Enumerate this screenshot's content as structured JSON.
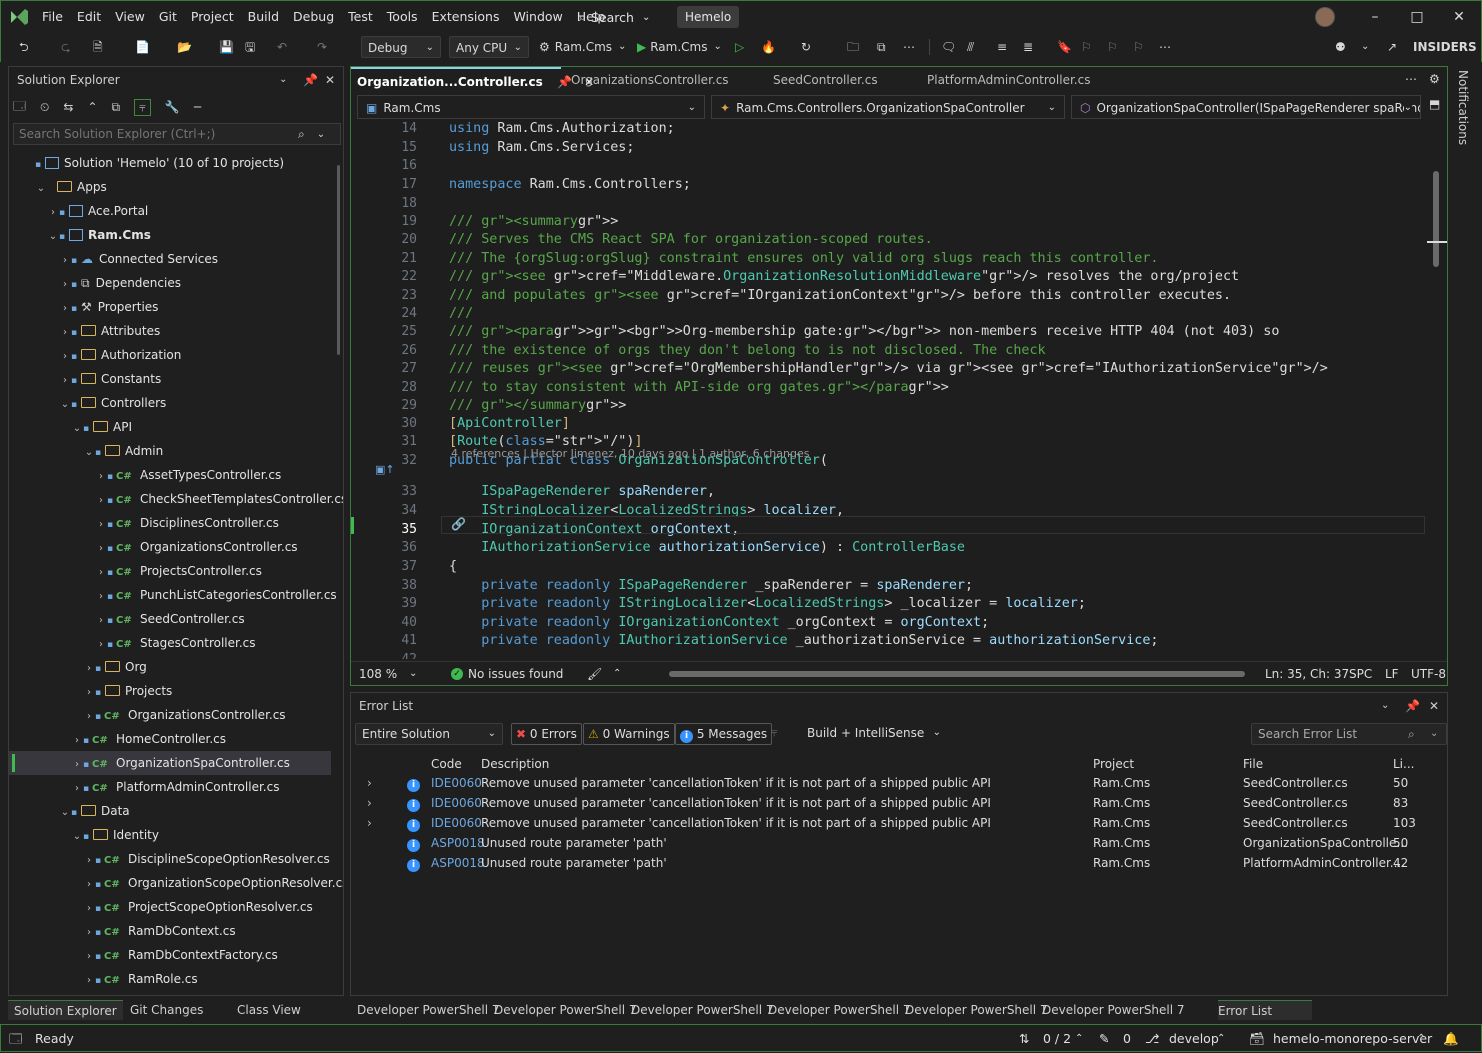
{
  "menu": [
    "File",
    "Edit",
    "View",
    "Git",
    "Project",
    "Build",
    "Debug",
    "Test",
    "Tools",
    "Extensions",
    "Window",
    "Help"
  ],
  "search_label": "Search",
  "solution_name": "Hemelo",
  "toolbar": {
    "config": "Debug",
    "platform": "Any CPU",
    "startup": "Ram.Cms",
    "run": "Ram.Cms",
    "insiders": "INSIDERS"
  },
  "solution_explorer": {
    "title": "Solution Explorer",
    "search_placeholder": "Search Solution Explorer (Ctrl+;)",
    "items": [
      {
        "label": "Solution 'Hemelo' (10 of 10 projects)",
        "kind": "solution"
      },
      {
        "label": "Apps",
        "kind": "folder"
      },
      {
        "label": "Ace.Portal",
        "kind": "project"
      },
      {
        "label": "Ram.Cms",
        "kind": "project"
      },
      {
        "label": "Connected Services",
        "kind": "service"
      },
      {
        "label": "Dependencies",
        "kind": "deps"
      },
      {
        "label": "Properties",
        "kind": "props"
      },
      {
        "label": "Attributes",
        "kind": "folder"
      },
      {
        "label": "Authorization",
        "kind": "folder"
      },
      {
        "label": "Constants",
        "kind": "folder"
      },
      {
        "label": "Controllers",
        "kind": "folder"
      },
      {
        "label": "API",
        "kind": "folder"
      },
      {
        "label": "Admin",
        "kind": "folder"
      },
      {
        "label": "AssetTypesController.cs",
        "kind": "cs"
      },
      {
        "label": "CheckSheetTemplatesController.cs",
        "kind": "cs"
      },
      {
        "label": "DisciplinesController.cs",
        "kind": "cs"
      },
      {
        "label": "OrganizationsController.cs",
        "kind": "cs"
      },
      {
        "label": "ProjectsController.cs",
        "kind": "cs"
      },
      {
        "label": "PunchListCategoriesController.cs",
        "kind": "cs"
      },
      {
        "label": "SeedController.cs",
        "kind": "cs"
      },
      {
        "label": "StagesController.cs",
        "kind": "cs"
      },
      {
        "label": "Org",
        "kind": "folder"
      },
      {
        "label": "Projects",
        "kind": "folder"
      },
      {
        "label": "OrganizationsController.cs",
        "kind": "cs"
      },
      {
        "label": "HomeController.cs",
        "kind": "cs"
      },
      {
        "label": "OrganizationSpaController.cs",
        "kind": "cs"
      },
      {
        "label": "PlatformAdminController.cs",
        "kind": "cs"
      },
      {
        "label": "Data",
        "kind": "folder"
      },
      {
        "label": "Identity",
        "kind": "folder"
      },
      {
        "label": "DisciplineScopeOptionResolver.cs",
        "kind": "cs"
      },
      {
        "label": "OrganizationScopeOptionResolver.cs",
        "kind": "cs"
      },
      {
        "label": "ProjectScopeOptionResolver.cs",
        "kind": "cs"
      },
      {
        "label": "RamDbContext.cs",
        "kind": "cs"
      },
      {
        "label": "RamDbContextFactory.cs",
        "kind": "cs"
      },
      {
        "label": "RamRole.cs",
        "kind": "cs"
      }
    ],
    "bottom_tabs": [
      "Solution Explorer",
      "Git Changes",
      "Class View"
    ]
  },
  "editor": {
    "tabs": [
      "Organization...Controller.cs",
      "OrganizationsController.cs",
      "SeedController.cs",
      "PlatformAdminController.cs"
    ],
    "nav_project": "Ram.Cms",
    "nav_class": "Ram.Cms.Controllers.OrganizationSpaController",
    "nav_member": "OrganizationSpaController(ISpaPageRenderer spaRender",
    "codelens": "4 references | Hector Jimenez, 10 days ago | 1 author, 6 changes",
    "zoom": "108 %",
    "issues": "No issues found",
    "position": "Ln: 35, Ch: 37",
    "spc": "SPC",
    "eol": "LF",
    "encoding": "UTF-8"
  },
  "code_lines": [
    {
      "n": "14",
      "t": "using Ram.Cms.Authorization;"
    },
    {
      "n": "15",
      "t": "using Ram.Cms.Services;"
    },
    {
      "n": "16",
      "t": ""
    },
    {
      "n": "17",
      "t": "namespace Ram.Cms.Controllers;"
    },
    {
      "n": "18",
      "t": ""
    },
    {
      "n": "19",
      "t": "/// <summary>"
    },
    {
      "n": "20",
      "t": "/// Serves the CMS React SPA for organization-scoped routes."
    },
    {
      "n": "21",
      "t": "/// The {orgSlug:orgSlug} constraint ensures only valid org slugs reach this controller."
    },
    {
      "n": "22",
      "t": "/// <see cref=\"Middleware.OrganizationResolutionMiddleware\"/> resolves the org/project"
    },
    {
      "n": "23",
      "t": "/// and populates <see cref=\"IOrganizationContext\"/> before this controller executes."
    },
    {
      "n": "24",
      "t": "///"
    },
    {
      "n": "25",
      "t": "/// <para><b>Org-membership gate:</b> non-members receive HTTP 404 (not 403) so"
    },
    {
      "n": "26",
      "t": "/// the existence of orgs they don't belong to is not disclosed. The check"
    },
    {
      "n": "27",
      "t": "/// reuses <see cref=\"OrgMembershipHandler\"/> via <see cref=\"IAuthorizationService\"/>"
    },
    {
      "n": "28",
      "t": "/// to stay consistent with API-side org gates.</para>"
    },
    {
      "n": "29",
      "t": "/// </summary>"
    },
    {
      "n": "30",
      "t": "[ApiController]"
    },
    {
      "n": "31",
      "t": "[Route(\"/\")]"
    },
    {
      "n": "32",
      "t": "public partial class OrganizationSpaController("
    },
    {
      "n": "33",
      "t": "    ISpaPageRenderer spaRenderer,"
    },
    {
      "n": "34",
      "t": "    IStringLocalizer<LocalizedStrings> localizer,"
    },
    {
      "n": "35",
      "t": "    IOrganizationContext orgContext,"
    },
    {
      "n": "36",
      "t": "    IAuthorizationService authorizationService) : ControllerBase"
    },
    {
      "n": "37",
      "t": "{"
    },
    {
      "n": "38",
      "t": "    private readonly ISpaPageRenderer _spaRenderer = spaRenderer;"
    },
    {
      "n": "39",
      "t": "    private readonly IStringLocalizer<LocalizedStrings> _localizer = localizer;"
    },
    {
      "n": "40",
      "t": "    private readonly IOrganizationContext _orgContext = orgContext;"
    },
    {
      "n": "41",
      "t": "    private readonly IAuthorizationService _authorizationService = authorizationService;"
    },
    {
      "n": "42",
      "t": ""
    }
  ],
  "error_list": {
    "title": "Error List",
    "scope": "Entire Solution",
    "errors": "0 Errors",
    "warnings": "0 Warnings",
    "messages": "5 Messages",
    "source": "Build + IntelliSense",
    "search_placeholder": "Search Error List",
    "columns": [
      "Code",
      "Description",
      "Project",
      "File",
      "Li..."
    ],
    "rows": [
      {
        "code": "IDE0060",
        "desc": "Remove unused parameter 'cancellationToken' if it is not part of a shipped public API",
        "project": "Ram.Cms",
        "file": "SeedController.cs",
        "line": "50",
        "expandable": true
      },
      {
        "code": "IDE0060",
        "desc": "Remove unused parameter 'cancellationToken' if it is not part of a shipped public API",
        "project": "Ram.Cms",
        "file": "SeedController.cs",
        "line": "83",
        "expandable": true
      },
      {
        "code": "IDE0060",
        "desc": "Remove unused parameter 'cancellationToken' if it is not part of a shipped public API",
        "project": "Ram.Cms",
        "file": "SeedController.cs",
        "line": "103",
        "expandable": true
      },
      {
        "code": "ASP0018",
        "desc": "Unused route parameter 'path'",
        "project": "Ram.Cms",
        "file": "OrganizationSpaControlle...",
        "line": "50",
        "expandable": false
      },
      {
        "code": "ASP0018",
        "desc": "Unused route parameter 'path'",
        "project": "Ram.Cms",
        "file": "PlatformAdminController....",
        "line": "42",
        "expandable": false
      }
    ]
  },
  "bottom_tabs": [
    "Developer PowerShell 7",
    "Developer PowerShell 7",
    "Developer PowerShell 7",
    "Developer PowerShell 7",
    "Developer PowerShell 7",
    "Developer PowerShell 7",
    "Error List"
  ],
  "notifications_label": "Notifications",
  "status": {
    "ready": "Ready",
    "sync": "0 / 2",
    "edits": "0",
    "branch": "develop",
    "repo": "hemelo-monorepo-server"
  },
  "colors": {
    "accent_border": "#3a7a3a",
    "keyword": "#569cd6",
    "type": "#4ec9b0",
    "comment": "#57a64a",
    "info": "#3794ff"
  }
}
